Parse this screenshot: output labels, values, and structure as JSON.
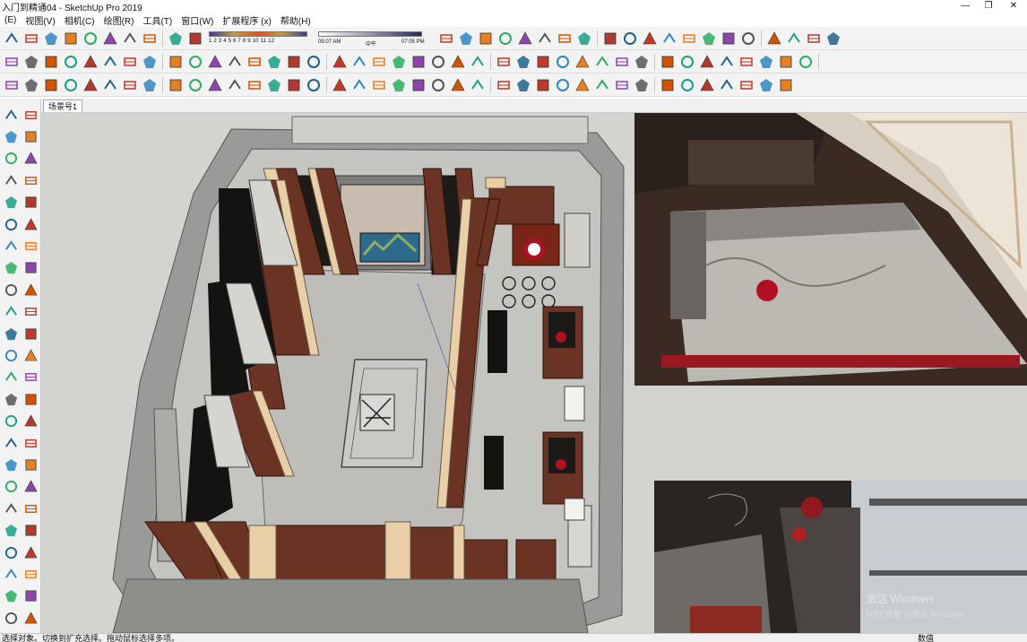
{
  "window": {
    "title": "入门到精通04 - SketchUp Pro 2019",
    "controls": [
      "—",
      "❐",
      "✕"
    ]
  },
  "menu": [
    "(E)",
    "视图(V)",
    "相机(C)",
    "绘图(R)",
    "工具(T)",
    "窗口(W)",
    "扩展程序 (x)",
    "帮助(H)"
  ],
  "shadow": {
    "months": "1 2 3 4 5 6 7 8 9 10 11 12",
    "sunrise": "05:07 AM",
    "noon": "中午",
    "sunset": "07:05 PM"
  },
  "scene_tab": "场景号1",
  "watermark": {
    "line1": "激活 Windows",
    "line2": "转到\"设置\"以激活 Windows。"
  },
  "status": {
    "hint": "选择对象。切换到扩充选择。拖动鼠标选择多项。",
    "measurements_label": "数值"
  },
  "colors": {
    "wood": "#6b3323",
    "beige": "#e8cfa8",
    "floor": "#bebdba",
    "wall": "#8c8c8a",
    "accent_red": "#b01020"
  },
  "icons": {
    "row1": [
      "new-file-icon",
      "cut-icon",
      "copy-icon",
      "paste-icon",
      "erase-icon",
      "undo-icon",
      "redo-icon",
      "print-icon",
      "model-info-icon",
      "eraser-icon"
    ],
    "row1_right": [
      "warehouse-icon",
      "home-icon",
      "house-icon",
      "component-icon",
      "box-icon",
      "rotate-icon",
      "section-icon",
      "paint-icon",
      "zoom-icon",
      "zoom-window-icon",
      "zoom-extents-icon",
      "position-camera-icon",
      "walk-icon",
      "look-around-icon",
      "style-icon",
      "material-icon",
      "axes-icon",
      "dimension-icon",
      "text-icon",
      "protractor-icon"
    ],
    "row2": [
      "select-icon",
      "x-ray-icon",
      "back-edges-icon",
      "wireframe-icon",
      "hidden-line-icon",
      "shaded-icon",
      "textured-icon",
      "monochrome-icon",
      "iso-view-icon",
      "top-view-icon",
      "front-view-icon",
      "right-view-icon",
      "back-view-icon",
      "left-view-icon",
      "push-pull-icon",
      "follow-me-icon",
      "offset-icon",
      "move-icon",
      "rotate-tool-icon",
      "scale-icon",
      "tape-icon",
      "line-icon",
      "arc-icon",
      "circle-icon",
      "polygon-icon",
      "rectangle-icon",
      "freehand-icon",
      "orbit-icon",
      "pan-icon",
      "zoom-tool-icon",
      "layer-icon",
      "outliner-icon",
      "entity-info-icon",
      "shadow-icon",
      "fog-icon",
      "match-photo-icon",
      "soften-edges-icon",
      "section-plane-icon",
      "component-options-icon",
      "scene-icon"
    ],
    "row3": [
      "trash-icon",
      "solid-tools-icon",
      "intersect-icon",
      "union-icon",
      "subtract-icon",
      "trim-icon",
      "split-icon",
      "outer-shell-icon",
      "sandbox-icon",
      "from-contours-icon",
      "from-scratch-icon",
      "smoove-icon",
      "stamp-icon",
      "drape-icon",
      "add-detail-icon",
      "flip-edge-icon",
      "lights-icon",
      "camera-icon",
      "cube-icon",
      "sphere-icon",
      "grid-icon",
      "fps-icon",
      "curve-icon",
      "color-icon",
      "sync-icon",
      "link-icon",
      "frame-icon",
      "spiral-icon",
      "path-icon",
      "weld-icon",
      "joint-icon",
      "bezier-icon",
      "render-icon",
      "export-icon",
      "chevron-icon",
      "wave-icon",
      "line-tool-icon",
      "diag-icon",
      "check-icon"
    ],
    "left": [
      "select-tool-icon",
      "component-tool-icon",
      "paint-tool-icon",
      "eraser-tool-icon",
      "line-tool-icon",
      "freehand-tool-icon",
      "rectangle-tool-icon",
      "rotated-rect-icon",
      "circle-tool-icon",
      "polygon-tool-icon",
      "arc-tool-icon",
      "pie-icon",
      "push-pull-tool-icon",
      "follow-me-tool-icon",
      "move-tool-icon",
      "rotate-tool-left-icon",
      "scale-tool-icon",
      "offset-tool-icon",
      "tape-tool-icon",
      "dimension-tool-icon",
      "protractor-tool-icon",
      "text-tool-icon",
      "axes-tool-icon",
      "3d-text-icon",
      "orbit-tool-icon",
      "pan-tool-icon",
      "zoom-tool-left-icon",
      "zoom-window-tool-icon",
      "zoom-extents-tool-icon",
      "previous-view-icon",
      "position-camera-tool-icon",
      "look-around-tool-icon",
      "walk-tool-icon",
      "section-tool-icon",
      "sandbox-left-icon",
      "stamp-left-icon",
      "drape-left-icon",
      "add-detail-left-icon",
      "flip-left-icon",
      "smoove-left-icon",
      "contours-left-icon",
      "scratch-left-icon",
      "follow-left-icon",
      "wave-left-icon",
      "curve-left-icon",
      "sphere-left-icon",
      "cube-left-icon",
      "light-left-icon"
    ]
  }
}
